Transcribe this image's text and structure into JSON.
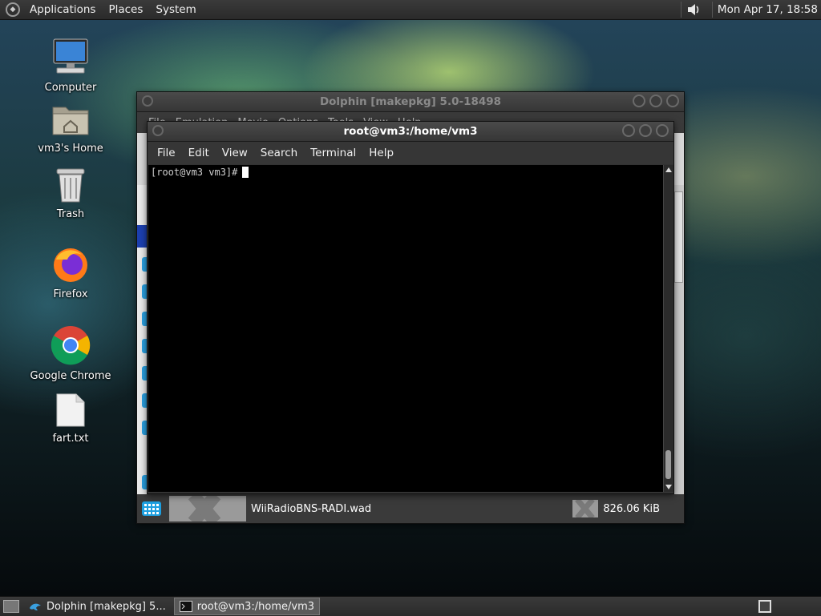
{
  "top_panel": {
    "menus": [
      "Applications",
      "Places",
      "System"
    ],
    "clock": "Mon Apr 17, 18:58"
  },
  "desktop_icons": [
    {
      "label": "Computer",
      "icon": "computer-icon"
    },
    {
      "label": "vm3's Home",
      "icon": "home-folder-icon"
    },
    {
      "label": "Trash",
      "icon": "trash-icon"
    },
    {
      "label": "Firefox",
      "icon": "firefox-icon"
    },
    {
      "label": "Google Chrome",
      "icon": "chrome-icon"
    },
    {
      "label": "fart.txt",
      "icon": "text-file-icon"
    }
  ],
  "dolphin": {
    "title": "Dolphin [makepkg] 5.0-18498",
    "menu": [
      "File",
      "Emulation",
      "Movie",
      "Options",
      "Tools",
      "View",
      "Help"
    ],
    "status": {
      "filename": "WiiRadioBNS-RADI.wad",
      "size": "826.06 KiB"
    }
  },
  "terminal": {
    "title": "root@vm3:/home/vm3",
    "menu": [
      "File",
      "Edit",
      "View",
      "Search",
      "Terminal",
      "Help"
    ],
    "prompt": "[root@vm3 vm3]#"
  },
  "taskbar": {
    "items": [
      {
        "label": "Dolphin [makepkg] 5...",
        "active": false
      },
      {
        "label": "root@vm3:/home/vm3",
        "active": true
      }
    ]
  },
  "colors": {
    "accent": "#1d9fe0",
    "panel": "#2f2f2f"
  }
}
